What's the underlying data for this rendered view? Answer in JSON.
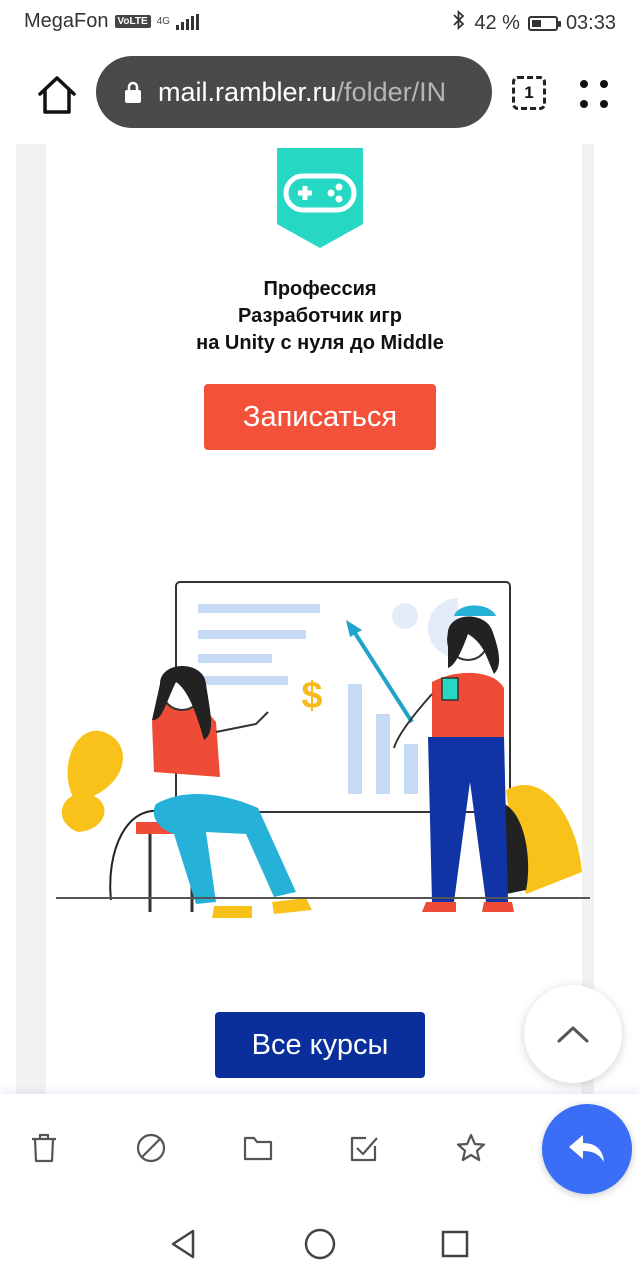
{
  "status_bar": {
    "carrier": "MegaFon",
    "volte": "VoLTE",
    "network": "4G",
    "bluetooth_icon": "bluetooth-icon",
    "battery_percent": "42 %",
    "battery_level": 0.42,
    "time": "03:33"
  },
  "browser": {
    "home_icon": "home-icon",
    "lock_icon": "lock-icon",
    "url_host": "mail.rambler.ru",
    "url_path": "/folder/IN",
    "tab_count": "1",
    "menu_icon": "menu-dots-icon"
  },
  "email": {
    "badge_icon": "gamepad-icon",
    "badge_color": "#26d7c3",
    "title_lines": [
      "Профессия",
      "Разработчик игр",
      "на Unity с нуля до Middle"
    ],
    "signup_label": "Записаться",
    "signup_color": "#f4513a",
    "illustration_symbol": "$",
    "all_courses_label": "Все курсы",
    "all_courses_color": "#0b2f9a"
  },
  "scroll_top_icon": "chevron-up-icon",
  "mail_actions": [
    {
      "name": "delete",
      "icon": "trash-icon"
    },
    {
      "name": "spam",
      "icon": "block-icon"
    },
    {
      "name": "move",
      "icon": "folder-icon"
    },
    {
      "name": "mark-read",
      "icon": "checkbox-icon"
    },
    {
      "name": "favorite",
      "icon": "star-icon"
    }
  ],
  "reply": {
    "icon": "reply-icon",
    "color": "#3b6ef7"
  },
  "system_nav": {
    "back_icon": "back-triangle-icon",
    "home_icon": "home-circle-icon",
    "recents_icon": "recents-square-icon"
  }
}
